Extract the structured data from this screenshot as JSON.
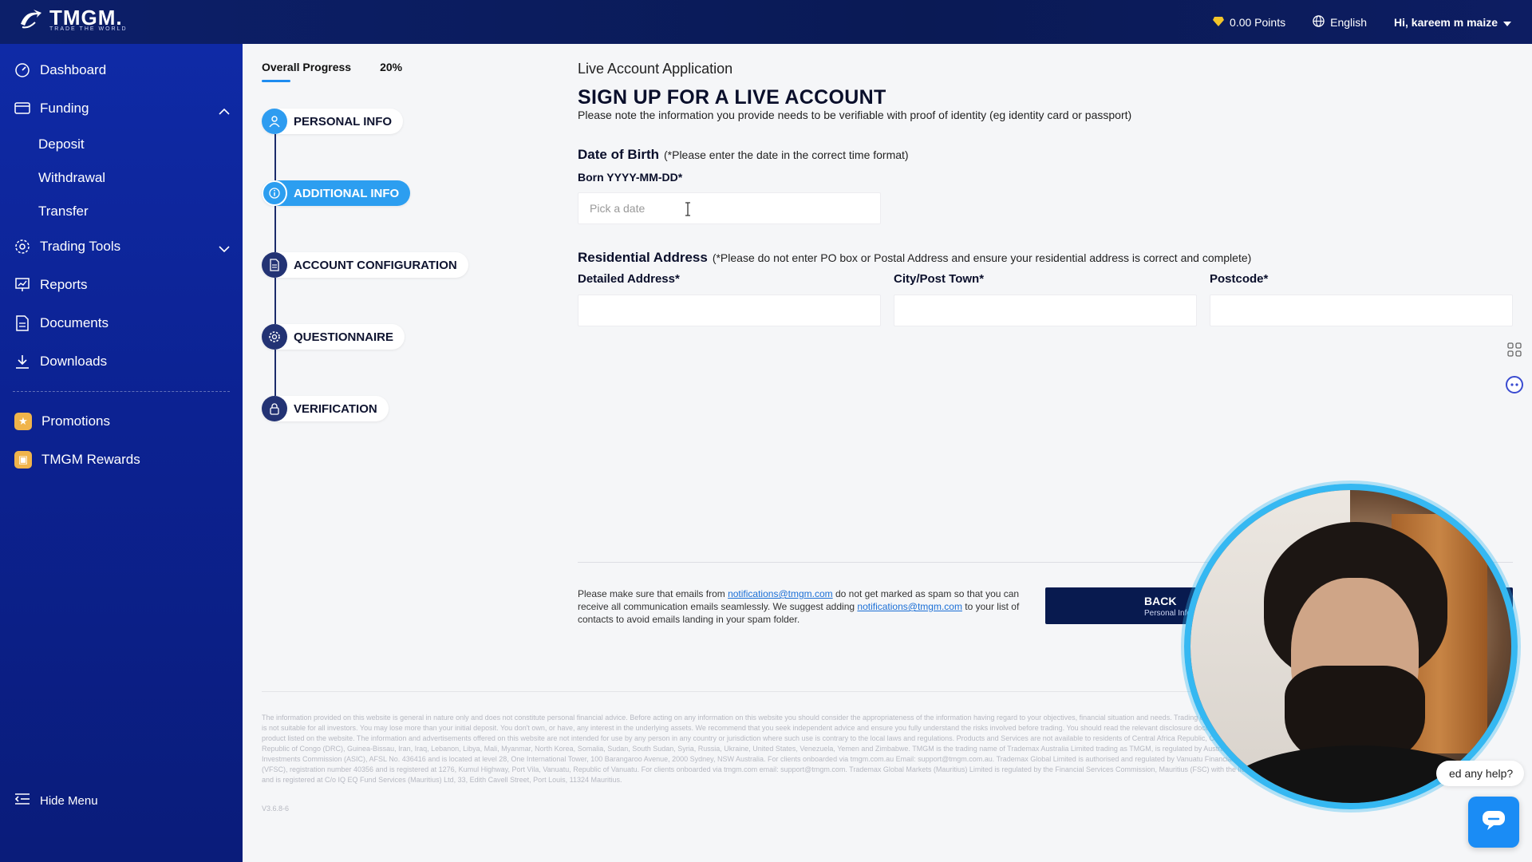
{
  "header": {
    "logo_text": "TMGM.",
    "logo_tagline": "TRADE THE WORLD",
    "points": "0.00 Points",
    "language": "English",
    "user_greeting": "Hi, kareem m maize"
  },
  "sidebar": {
    "items": [
      {
        "label": "Dashboard",
        "icon": "dashboard-icon"
      },
      {
        "label": "Funding",
        "icon": "funding-icon"
      },
      {
        "label": "Deposit"
      },
      {
        "label": "Withdrawal"
      },
      {
        "label": "Transfer"
      },
      {
        "label": "Trading Tools",
        "icon": "trading-tools-icon"
      },
      {
        "label": "Reports",
        "icon": "reports-icon"
      },
      {
        "label": "Documents",
        "icon": "documents-icon"
      },
      {
        "label": "Downloads",
        "icon": "download-icon"
      },
      {
        "label": "Promotions",
        "icon": "promotions-icon"
      },
      {
        "label": "TMGM Rewards",
        "icon": "rewards-icon"
      }
    ],
    "hide_menu": "Hide Menu"
  },
  "progress": {
    "label": "Overall Progress",
    "value": "20%",
    "steps": [
      {
        "label": "PERSONAL INFO",
        "state": "done"
      },
      {
        "label": "ADDITIONAL INFO",
        "state": "active"
      },
      {
        "label": "ACCOUNT CONFIGURATION",
        "state": "pending"
      },
      {
        "label": "QUESTIONNAIRE",
        "state": "pending"
      },
      {
        "label": "VERIFICATION",
        "state": "pending"
      }
    ]
  },
  "form": {
    "app_title": "Live Account Application",
    "title": "SIGN UP FOR A LIVE ACCOUNT",
    "note": "Please note the information you provide needs to be verifiable with proof of identity (eg identity card or passport)",
    "dob": {
      "title": "Date of Birth",
      "note": "(*Please enter the date in the correct time format)",
      "label": "Born YYYY-MM-DD*",
      "placeholder": "Pick a date"
    },
    "address": {
      "title": "Residential Address",
      "note": "(*Please do not enter PO box or Postal Address and ensure your residential address is correct and complete)",
      "detailed_label": "Detailed Address*",
      "city_label": "City/Post Town*",
      "postcode_label": "Postcode*"
    },
    "mail_note_1": "Please make sure that emails from ",
    "mail_email": "notifications@tmgm.com",
    "mail_note_2": " do not get marked as spam so that you can receive all communication emails seamlessly. We suggest adding ",
    "mail_note_3": " to your list of contacts to avoid emails landing in your spam folder.",
    "back_label": "BACK",
    "back_sub": "Personal Info"
  },
  "footer": {
    "disclaimer": "The information provided on this website is general in nature only and does not constitute personal financial advice. Before acting on any information on this website you should consider the appropriateness of the information having regard to your objectives, financial situation and needs. Trading derivatives carries significant risks and is not suitable for all investors. You may lose more than your initial deposit. You don't own, or have, any interest in the underlying assets. We recommend that you seek independent advice and ensure you fully understand the risks involved before trading. You should read the relevant disclosure documents before you acquire any product listed on the website. The information and advertisements offered on this website are not intended for use by any person in any country or jurisdiction where such use is contrary to the local laws and regulations. Products and Services are not available to residents of Central Africa Republic, Crimea, Cuba, Democratic Republic of Congo (DRC), Guinea-Bissau, Iran, Iraq, Lebanon, Libya, Mali, Myanmar, North Korea, Somalia, Sudan, South Sudan, Syria, Russia, Ukraine, United States, Venezuela, Yemen and Zimbabwe. TMGM is the trading name of Trademax Australia Limited trading as TMGM, is regulated by Australian Securities and Investments Commission (ASIC), AFSL No. 436416 and is located at level 28, One International Tower, 100 Barangaroo Avenue, 2000 Sydney, NSW Australia. For clients onboarded via tmgm.com.au Email: support@tmgm.com.au. Trademax Global Limited is authorised and regulated by Vanuatu Financial Services Commission (VFSC), registration number 40356 and is registered at 1276, Kumul Highway, Port Vila, Vanuatu, Republic of Vanuatu. For clients onboarded via tmgm.com email: support@tmgm.com. Trademax Global Markets (Mauritius) Limited is regulated by the Financial Services Commission, Mauritius (FSC) with the licence no. GB22201012, and is registered at C/o IQ EQ Fund Services (Mauritius) Ltd, 33, Edith Cavell Street, Port Louis, 11324 Mauritius.",
    "version": "V3.6.8-6"
  },
  "help": {
    "text": "ed any help?"
  },
  "colors": {
    "sidebar": "#0f2aa6",
    "header": "#0c1f6a",
    "accent": "#2c9ef0",
    "back_button": "#081a4f"
  }
}
